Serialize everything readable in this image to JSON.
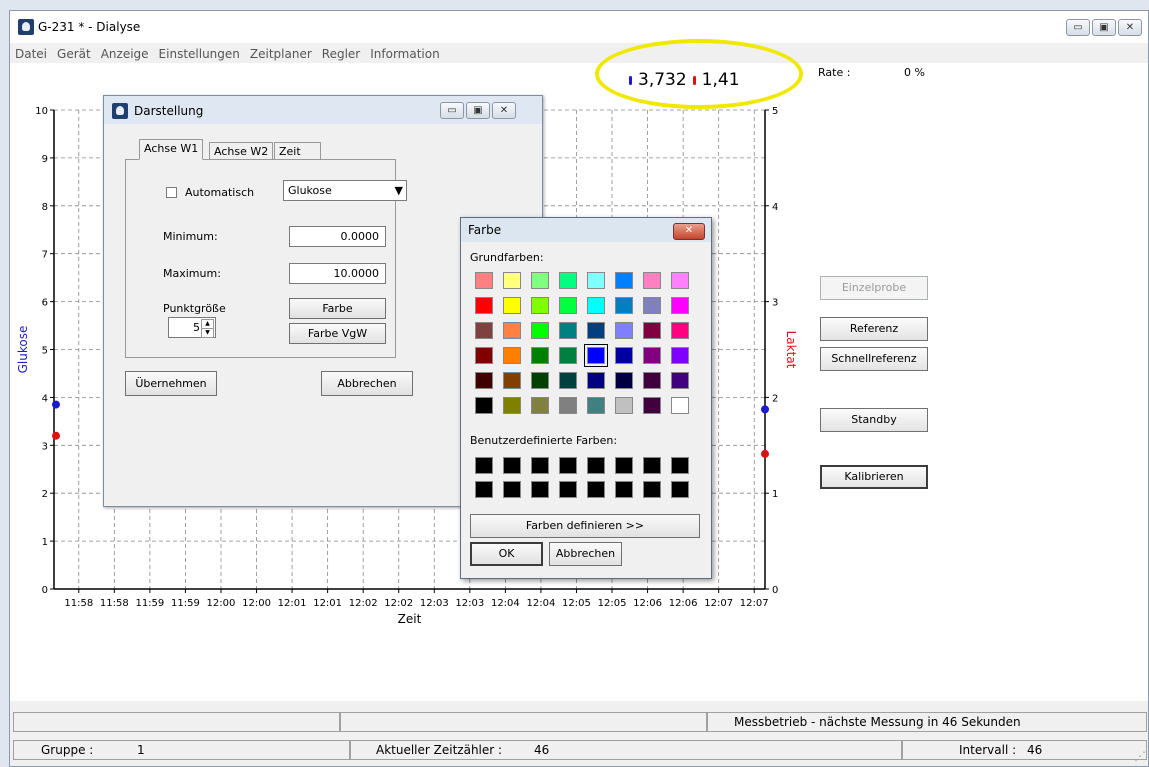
{
  "window": {
    "title": "G-231 * - Dialyse"
  },
  "menu": [
    "Datei",
    "Gerät",
    "Anzeige",
    "Einstellungen",
    "Zeitplaner",
    "Regler",
    "Information"
  ],
  "readout": {
    "glucose": "3,732",
    "lactate": "1,41"
  },
  "rate": {
    "label": "Rate :",
    "value": "0 %"
  },
  "chart": {
    "left_labels": [
      "10",
      "9",
      "8",
      "7",
      "6",
      "5",
      "4",
      "3",
      "2",
      "1",
      "0"
    ],
    "right_labels": [
      "5",
      "4",
      "3",
      "2",
      "1",
      "0"
    ],
    "left_axis_label": "Glukose",
    "right_axis_label": "Laktat",
    "x_labels": [
      "11:58",
      "11:58",
      "11:59",
      "11:59",
      "12:00",
      "12:00",
      "12:01",
      "12:01",
      "12:02",
      "12:02",
      "12:03",
      "12:03",
      "12:04",
      "12:04",
      "12:05",
      "12:05",
      "12:06",
      "12:06",
      "12:07",
      "12:07"
    ],
    "x_axis_label": "Zeit"
  },
  "chart_data": {
    "type": "scatter",
    "xlabel": "Zeit",
    "ylabel": "Glukose",
    "y2label": "Laktat",
    "ylim": [
      0,
      10
    ],
    "y2lim": [
      0,
      5
    ],
    "series": [
      {
        "name": "Glukose",
        "color": "#1a1ad0",
        "points": [
          [
            0,
            3.85
          ],
          [
            1,
            3.75
          ]
        ]
      },
      {
        "name": "Laktat",
        "color": "#e01010",
        "points": [
          [
            0,
            1.6
          ],
          [
            1,
            1.41
          ]
        ]
      }
    ]
  },
  "right_buttons": {
    "einzelprobe": "Einzelprobe",
    "referenz": "Referenz",
    "schnell": "Schnellreferenz",
    "standby": "Standby",
    "kalibrieren": "Kalibrieren"
  },
  "status": {
    "message": "Messbetrieb - nächste Messung in  46 Sekunden",
    "gruppe_label": "Gruppe :",
    "gruppe_value": "1",
    "zeitzaehler_label": "Aktueller Zeitzähler :",
    "zeitzaehler_value": "46",
    "intervall_label": "Intervall :",
    "intervall_value": "46"
  },
  "darstellung": {
    "title": "Darstellung",
    "tabs": [
      "Achse W1",
      "Achse W2",
      "Zeit"
    ],
    "automatisch": "Automatisch",
    "dropdown_value": "Glukose",
    "minimum_label": "Minimum:",
    "minimum_value": "0.0000",
    "maximum_label": "Maximum:",
    "maximum_value": "10.0000",
    "punktgroesse_label": "Punktgröße",
    "punktgroesse_value": "5",
    "farbe_btn": "Farbe",
    "farbe_vgw_btn": "Farbe VgW",
    "uebernehmen": "Übernehmen",
    "abbrechen": "Abbrechen"
  },
  "farbe": {
    "title": "Farbe",
    "grundfarben": "Grundfarben:",
    "benutzer": "Benutzerdefinierte Farben:",
    "definieren": "Farben definieren >>",
    "ok": "OK",
    "abbrechen": "Abbrechen",
    "basic_colors": [
      [
        "#ff8080",
        "#ffff80",
        "#80ff80",
        "#00ff80",
        "#80ffff",
        "#0080ff",
        "#ff80c0",
        "#ff80ff"
      ],
      [
        "#ff0000",
        "#ffff00",
        "#80ff00",
        "#00ff40",
        "#00ffff",
        "#0080c0",
        "#8080c0",
        "#ff00ff"
      ],
      [
        "#804040",
        "#ff8040",
        "#00ff00",
        "#008080",
        "#004080",
        "#8080ff",
        "#800040",
        "#ff0080"
      ],
      [
        "#800000",
        "#ff8000",
        "#008000",
        "#008040",
        "#0000ff",
        "#0000a0",
        "#800080",
        "#8000ff"
      ],
      [
        "#400000",
        "#804000",
        "#004000",
        "#004040",
        "#000080",
        "#000040",
        "#400040",
        "#400080"
      ],
      [
        "#000000",
        "#808000",
        "#808040",
        "#808080",
        "#408080",
        "#c0c0c0",
        "#400040",
        "#ffffff"
      ]
    ],
    "selected": [
      3,
      4
    ]
  }
}
